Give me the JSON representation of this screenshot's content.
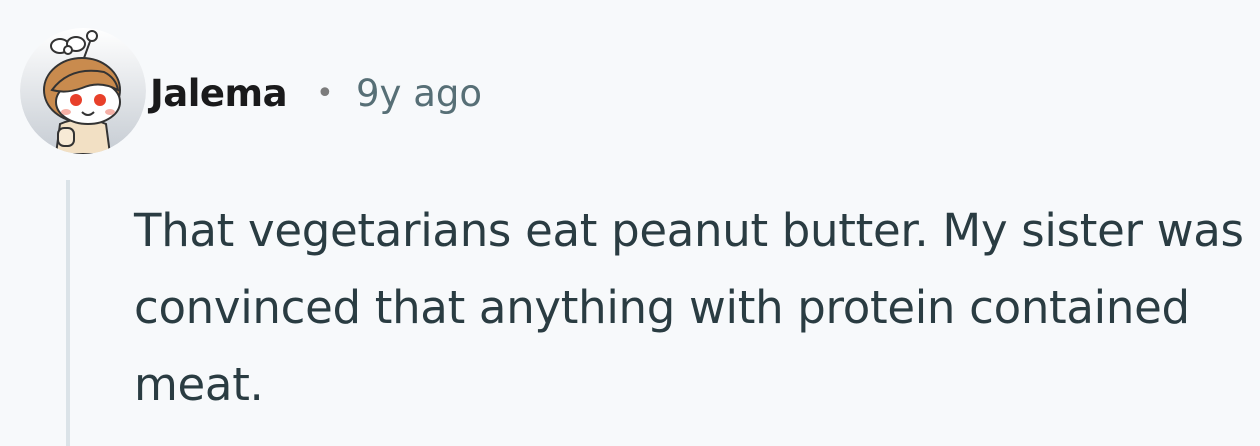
{
  "comment": {
    "author": "Jalema",
    "separator": "•",
    "timestamp": "9y ago",
    "avatar_icon": "snoo-avatar-icon",
    "body": "That vegetarians eat peanut butter. My sister was convinced that anything with protein contained meat."
  },
  "colors": {
    "background": "#f7f9fb",
    "author": "#1a1a1b",
    "timestamp": "#576f76",
    "body": "#2a3c42",
    "thread_line": "#dbe3e8"
  }
}
